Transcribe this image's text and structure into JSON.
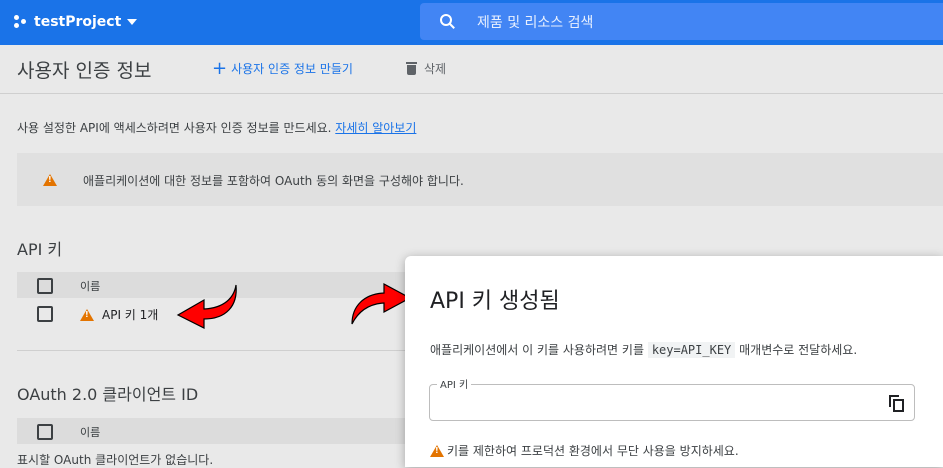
{
  "topbar": {
    "project_name": "testProject",
    "search_placeholder": "제품 및 리소스 검색"
  },
  "header": {
    "title": "사용자 인증 정보",
    "create_label": "사용자 인증 정보 만들기",
    "delete_label": "삭제"
  },
  "description": {
    "text": "사용 설정한 API에 액세스하려면 사용자 인증 정보를 만드세요.",
    "link": "자세히 알아보기"
  },
  "notice": {
    "text": "애플리케이션에 대한 정보를 포함하여 OAuth 동의 화면을 구성해야 합니다."
  },
  "api_keys": {
    "title": "API 키",
    "col_name": "이름",
    "rows": [
      {
        "name": "API 키 1개"
      }
    ]
  },
  "oauth": {
    "title": "OAuth 2.0 클라이언트 ID",
    "col_name": "이름",
    "empty_text": "표시할 OAuth 클라이언트가 없습니다."
  },
  "dialog": {
    "title": "API 키 생성됨",
    "text_before": "애플리케이션에서 이 키를 사용하려면 키를",
    "code": "key=API_KEY",
    "text_after": "매개변수로 전달하세요.",
    "field_label": "API 키",
    "field_value": "",
    "warning": "키를 제한하여 프로덕션 환경에서 무단 사용을 방지하세요."
  },
  "colors": {
    "brand_blue": "#1a73e8",
    "warning_orange": "#e37400",
    "annotation_red": "#ff0000"
  },
  "icons": [
    "project-icon",
    "search-icon",
    "add-icon",
    "trash-icon",
    "warning-icon",
    "copy-icon",
    "red-arrow-icon"
  ]
}
